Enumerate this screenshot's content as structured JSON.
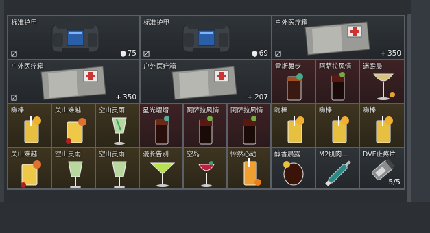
{
  "inventory": {
    "row1": [
      {
        "label": "标准护甲",
        "stat_icon": "shield-icon",
        "stat": "75"
      },
      {
        "label": "标准护甲",
        "stat_icon": "shield-icon",
        "stat": "69"
      },
      {
        "label": "户外医疗箱",
        "stat_icon": "plus-icon",
        "stat": "350"
      }
    ],
    "row2": [
      {
        "label": "户外医疗箱",
        "stat_icon": "plus-icon",
        "stat": "350"
      },
      {
        "label": "户外医疗箱",
        "stat_icon": "plus-icon",
        "stat": "207"
      },
      {
        "label": "雷斯舞步"
      },
      {
        "label": "阿萨拉风情"
      },
      {
        "label": "迷雾晨"
      }
    ],
    "row3": [
      {
        "label": "嗨棒"
      },
      {
        "label": "关山难越"
      },
      {
        "label": "空山灵雨"
      },
      {
        "label": "星光熠熠"
      },
      {
        "label": "阿萨拉风情"
      },
      {
        "label": "阿萨拉风情"
      },
      {
        "label": "嗨棒"
      },
      {
        "label": "嗨棒"
      },
      {
        "label": "嗨棒"
      }
    ],
    "row4": [
      {
        "label": "关山难越"
      },
      {
        "label": "空山灵雨"
      },
      {
        "label": "空山灵雨"
      },
      {
        "label": "漫长告别"
      },
      {
        "label": "空岛"
      },
      {
        "label": "怦然心动"
      },
      {
        "label": "醇香晨露"
      },
      {
        "label": "M2肌肉..."
      },
      {
        "label": "DVE止疼片",
        "quantity": "5/5"
      }
    ]
  },
  "colors": {
    "accent_red": "#3e2224",
    "accent_yellow": "#3e3520",
    "accent_gray": "#2f3439"
  }
}
